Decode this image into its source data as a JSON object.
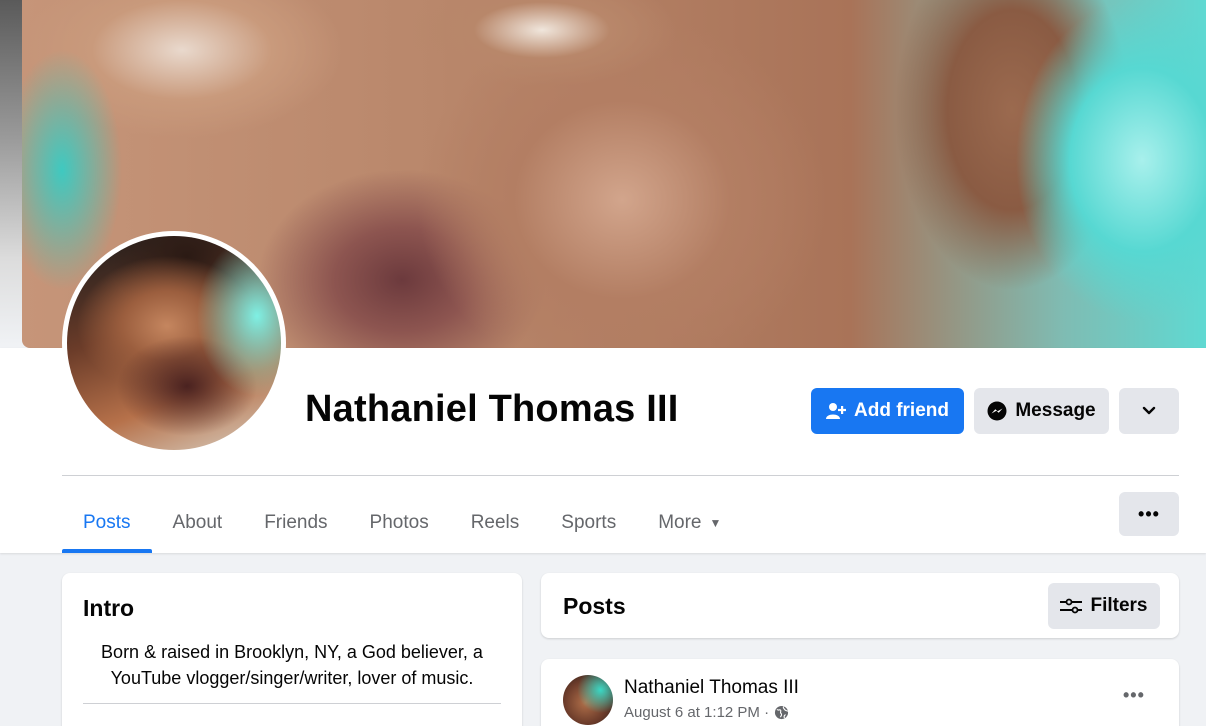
{
  "profile": {
    "name": "Nathaniel Thomas III"
  },
  "actions": {
    "add_friend": "Add friend",
    "message": "Message"
  },
  "tabs": [
    {
      "label": "Posts",
      "active": true
    },
    {
      "label": "About"
    },
    {
      "label": "Friends"
    },
    {
      "label": "Photos"
    },
    {
      "label": "Reels"
    },
    {
      "label": "Sports"
    },
    {
      "label": "More"
    }
  ],
  "more_menu": "•••",
  "intro": {
    "title": "Intro",
    "bio": "Born & raised in Brooklyn, NY, a God believer, a YouTube vlogger/singer/writer, lover of music."
  },
  "posts": {
    "title": "Posts",
    "filters_label": "Filters",
    "items": [
      {
        "author": "Nathaniel Thomas III",
        "date": "August 6 at 1:12 PM ·",
        "menu": "•••"
      }
    ]
  },
  "colors": {
    "accent": "#1877f2",
    "secondary_button": "#e4e6eb",
    "page_bg": "#f0f2f5",
    "muted_text": "#65676b"
  }
}
